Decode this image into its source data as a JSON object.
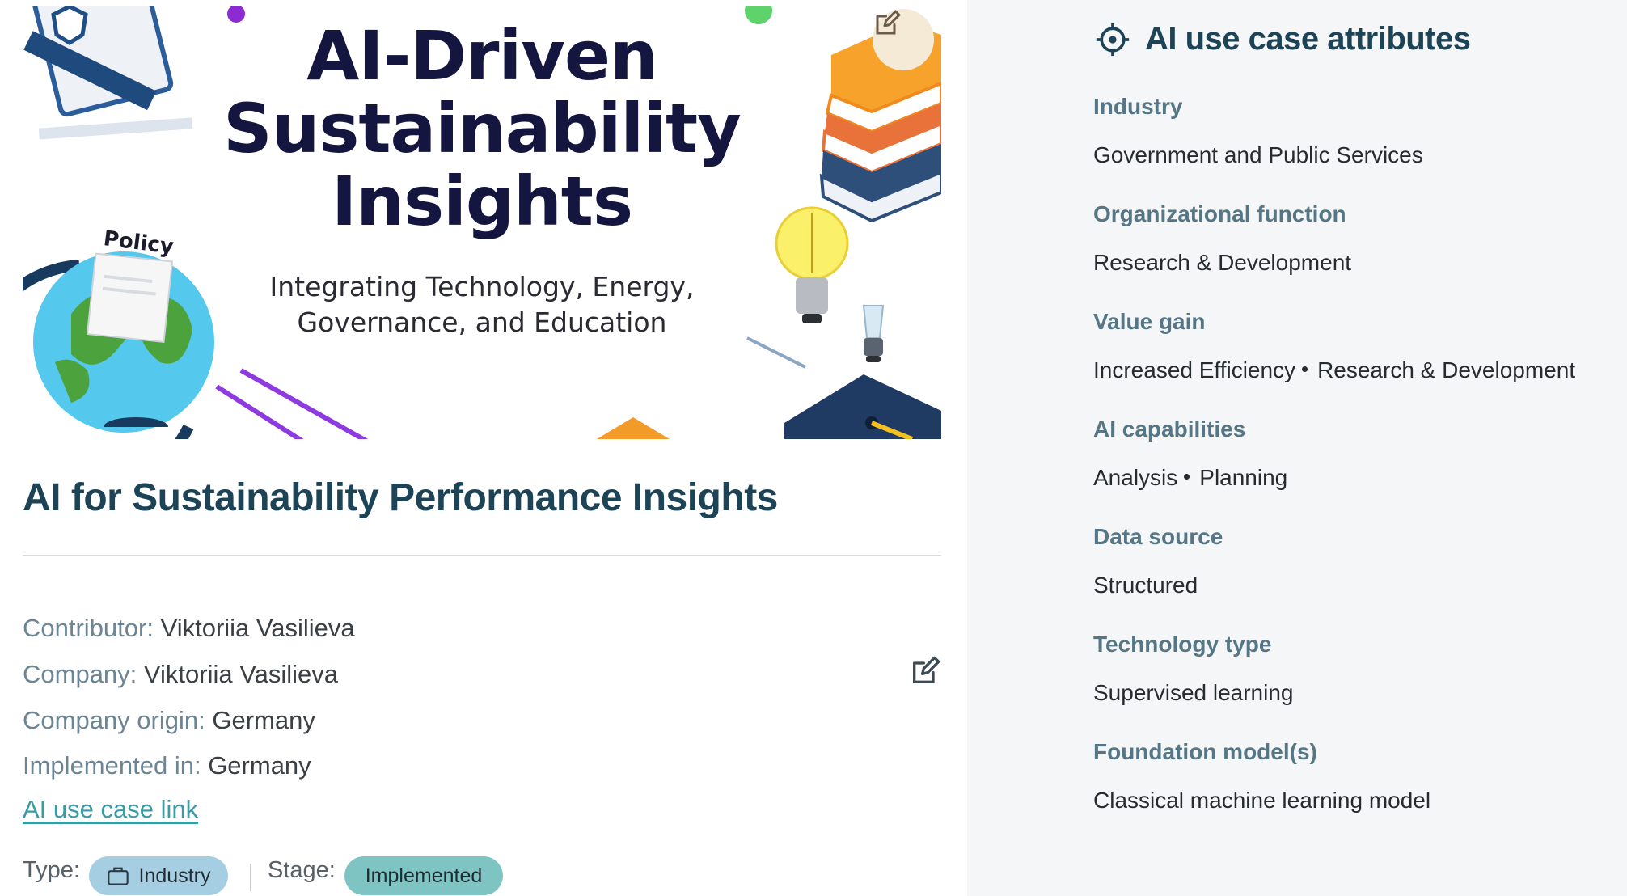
{
  "hero": {
    "title_lines": [
      "AI-Driven",
      "Sustainability",
      "Insights"
    ],
    "subtitle_lines": [
      "Integrating Technology, Energy,",
      "Governance, and Education"
    ],
    "policy_label": "Policy"
  },
  "page_title": "AI for Sustainability Performance Insights",
  "meta": {
    "contributor_key": "Contributor:",
    "contributor_value": "Viktoriia Vasilieva",
    "company_key": "Company:",
    "company_value": "Viktoriia Vasilieva",
    "origin_key": "Company origin:",
    "origin_value": "Germany",
    "implemented_key": "Implemented in:",
    "implemented_value": "Germany"
  },
  "link_text": "AI use case link",
  "type_label": "Type:",
  "type_value": "Industry",
  "stage_label": "Stage:",
  "stage_value": "Implemented",
  "panel": {
    "title": "AI use case attributes",
    "attributes": [
      {
        "key": "Industry",
        "values": [
          "Government and Public Services"
        ]
      },
      {
        "key": "Organizational function",
        "values": [
          "Research & Development"
        ]
      },
      {
        "key": "Value gain",
        "values": [
          "Increased Efficiency",
          "Research & Development"
        ]
      },
      {
        "key": "AI capabilities",
        "values": [
          "Analysis",
          "Planning"
        ]
      },
      {
        "key": "Data source",
        "values": [
          "Structured"
        ]
      },
      {
        "key": "Technology type",
        "values": [
          "Supervised learning"
        ]
      },
      {
        "key": "Foundation model(s)",
        "values": [
          "Classical machine learning model"
        ]
      }
    ]
  },
  "icons": {
    "hero_edit": "pencil-square-icon",
    "meta_edit": "pencil-square-icon",
    "panel_head": "target-icon",
    "type_pill": "briefcase-icon"
  },
  "colors": {
    "title": "#1d4356",
    "attribute_key": "#557684",
    "link": "#3c9aa5",
    "type_pill": "#a6cee2",
    "stage_pill": "#7dc4c3",
    "panel_bg": "#f4f6f8"
  }
}
